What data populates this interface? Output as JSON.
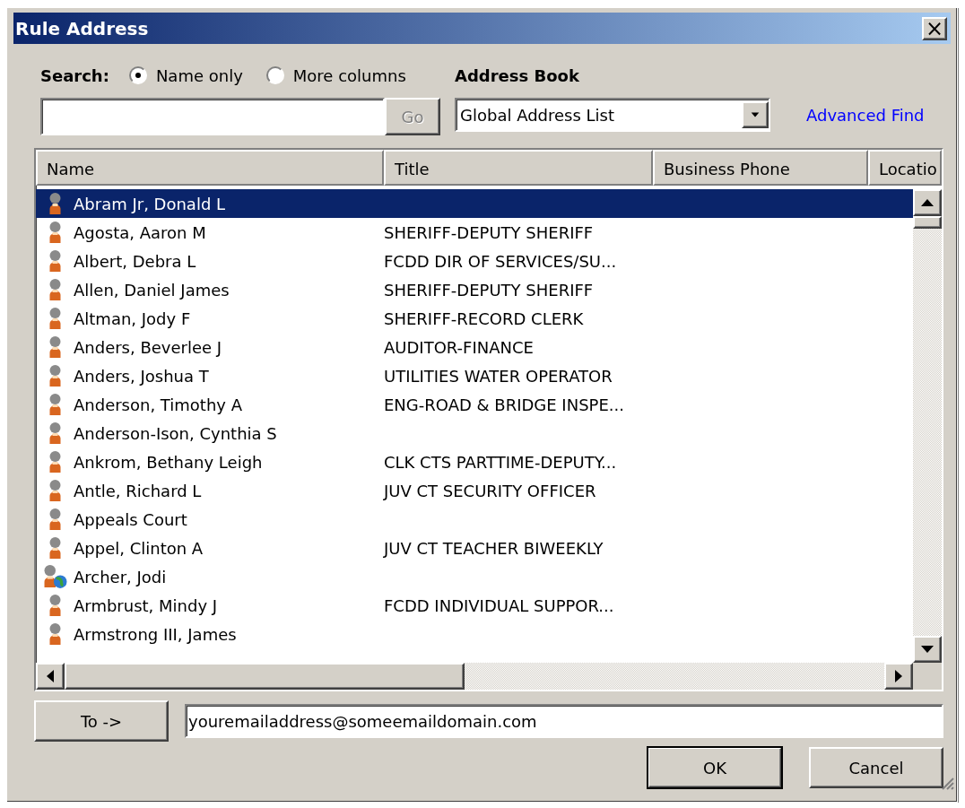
{
  "window": {
    "title": "Rule Address",
    "close": "×"
  },
  "search": {
    "label": "Search:",
    "options": [
      {
        "label": "Name only",
        "selected": true
      },
      {
        "label": "More columns",
        "selected": false
      }
    ],
    "button": "Go"
  },
  "address_book": {
    "label": "Address Book",
    "value": "Global Address List",
    "link": "Advanced Find"
  },
  "table": {
    "columns": [
      "Name",
      "Title",
      "Business Phone",
      "Locatio"
    ],
    "rows": [
      {
        "name": "Abram Jr, Donald L",
        "title": "",
        "kind": "user",
        "selected": true
      },
      {
        "name": "Agosta, Aaron M",
        "title": "SHERIFF-DEPUTY SHERIFF",
        "kind": "user",
        "selected": false
      },
      {
        "name": "Albert, Debra L",
        "title": "FCDD DIR OF SERVICES/SU...",
        "kind": "user",
        "selected": false
      },
      {
        "name": "Allen, Daniel James",
        "title": "SHERIFF-DEPUTY SHERIFF",
        "kind": "user",
        "selected": false
      },
      {
        "name": "Altman, Jody F",
        "title": "SHERIFF-RECORD CLERK",
        "kind": "user",
        "selected": false
      },
      {
        "name": "Anders, Beverlee J",
        "title": "AUDITOR-FINANCE",
        "kind": "user",
        "selected": false
      },
      {
        "name": "Anders, Joshua T",
        "title": "UTILITIES WATER OPERATOR",
        "kind": "user",
        "selected": false
      },
      {
        "name": "Anderson, Timothy A",
        "title": "ENG-ROAD & BRIDGE INSPE...",
        "kind": "user",
        "selected": false
      },
      {
        "name": "Anderson-Ison, Cynthia S",
        "title": "",
        "kind": "user",
        "selected": false
      },
      {
        "name": "Ankrom, Bethany Leigh",
        "title": "CLK CTS PARTTIME-DEPUTY...",
        "kind": "user",
        "selected": false
      },
      {
        "name": "Antle, Richard L",
        "title": "JUV CT SECURITY OFFICER",
        "kind": "user",
        "selected": false
      },
      {
        "name": "Appeals Court",
        "title": "",
        "kind": "user",
        "selected": false
      },
      {
        "name": "Appel, Clinton A",
        "title": "JUV CT TEACHER BIWEEKLY",
        "kind": "user",
        "selected": false
      },
      {
        "name": "Archer, Jodi",
        "title": "",
        "kind": "external",
        "selected": false
      },
      {
        "name": "Armbrust, Mindy J",
        "title": "FCDD INDIVIDUAL SUPPOR...",
        "kind": "user",
        "selected": false
      },
      {
        "name": "Armstrong III, James",
        "title": "",
        "kind": "user",
        "selected": false
      }
    ]
  },
  "recipient": {
    "button": "To ->",
    "value": "youremailaddress@someemaildomain.com"
  },
  "buttons": [
    {
      "label": "OK",
      "default": true
    },
    {
      "label": "Cancel",
      "default": false
    }
  ]
}
